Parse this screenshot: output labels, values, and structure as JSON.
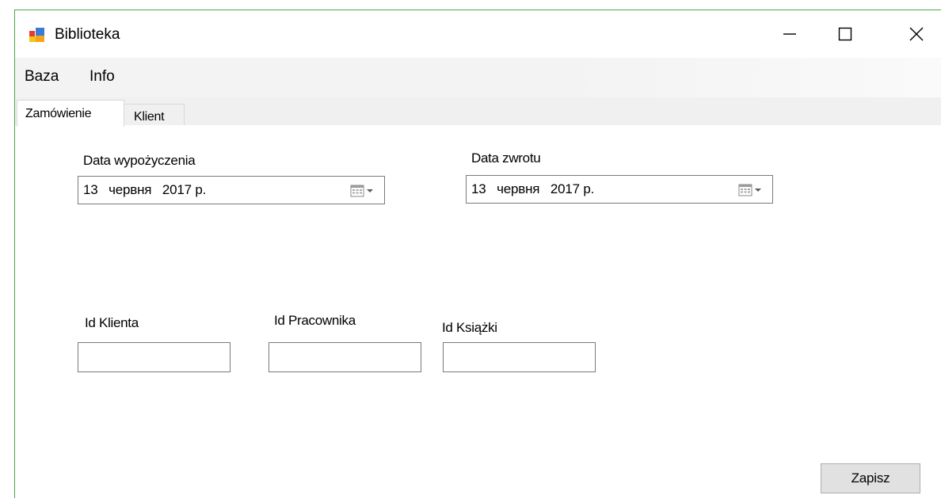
{
  "window": {
    "title": "Biblioteka",
    "icons": {
      "app": "app-icon",
      "minimize": "minimize-icon",
      "maximize": "maximize-icon",
      "close": "close-icon"
    }
  },
  "menu": {
    "items": [
      {
        "label": "Baza"
      },
      {
        "label": "Info"
      }
    ]
  },
  "tabs": [
    {
      "label": "Zamówienie",
      "active": true
    },
    {
      "label": "Klient",
      "active": false
    }
  ],
  "order": {
    "loan_date_label": "Data wypożyczenia",
    "loan_date_value": "13   червня   2017 р.",
    "return_date_label": "Data zwrotu",
    "return_date_value": "13   червня   2017 р.",
    "client_id_label": "Id Klienta",
    "client_id_value": "",
    "employee_id_label": "Id Pracownika",
    "employee_id_value": "",
    "book_id_label": "Id Książki",
    "book_id_value": "",
    "save_label": "Zapisz",
    "calendar_icon": "calendar-dropdown-icon"
  },
  "colors": {
    "window_border": "#4aa84a",
    "menubar_bg": "#f3f3f3",
    "tabstrip_bg": "#f0f0f0",
    "button_bg": "#e1e1e1"
  }
}
